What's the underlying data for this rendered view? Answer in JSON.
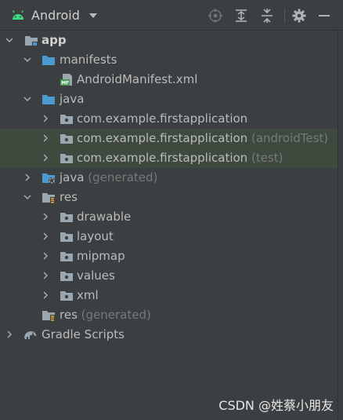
{
  "toolbar": {
    "view_title": "Android",
    "view_dropdown_icon": "caret-down-icon",
    "buttons": [
      "locate-icon",
      "expand-all-icon",
      "collapse-all-icon",
      "gear-icon",
      "minimize-icon"
    ]
  },
  "tree": {
    "nodes": [
      {
        "label": "app",
        "suffix": "",
        "icon": "module-folder-icon"
      },
      {
        "label": "manifests",
        "suffix": "",
        "icon": "folder-icon"
      },
      {
        "label": "AndroidManifest.xml",
        "suffix": "",
        "icon": "manifest-file-icon"
      },
      {
        "label": "java",
        "suffix": "",
        "icon": "source-folder-icon"
      },
      {
        "label": "com.example.firstapplication",
        "suffix": "",
        "icon": "package-icon"
      },
      {
        "label": "com.example.firstapplication",
        "suffix": "(androidTest)",
        "icon": "package-icon"
      },
      {
        "label": "com.example.firstapplication",
        "suffix": "(test)",
        "icon": "package-icon"
      },
      {
        "label": "java",
        "suffix": "(generated)",
        "icon": "generated-source-folder-icon"
      },
      {
        "label": "res",
        "suffix": "",
        "icon": "resource-folder-icon"
      },
      {
        "label": "drawable",
        "suffix": "",
        "icon": "package-icon"
      },
      {
        "label": "layout",
        "suffix": "",
        "icon": "package-icon"
      },
      {
        "label": "mipmap",
        "suffix": "",
        "icon": "package-icon"
      },
      {
        "label": "values",
        "suffix": "",
        "icon": "package-icon"
      },
      {
        "label": "xml",
        "suffix": "",
        "icon": "package-icon"
      },
      {
        "label": "res",
        "suffix": "(generated)",
        "icon": "resource-folder-icon"
      },
      {
        "label": "Gradle Scripts",
        "suffix": "",
        "icon": "gradle-elephant-icon"
      }
    ]
  },
  "watermark": "CSDN @姓蔡小朋友",
  "colors": {
    "background": "#3c3f41",
    "text": "#bbbbbb",
    "suffix_text": "#787878",
    "folder_blue": "#4b9bd0",
    "folder_gray": "#9aa7b0",
    "android_green": "#3ddc84",
    "highlight_row": "#3f4a3f"
  }
}
